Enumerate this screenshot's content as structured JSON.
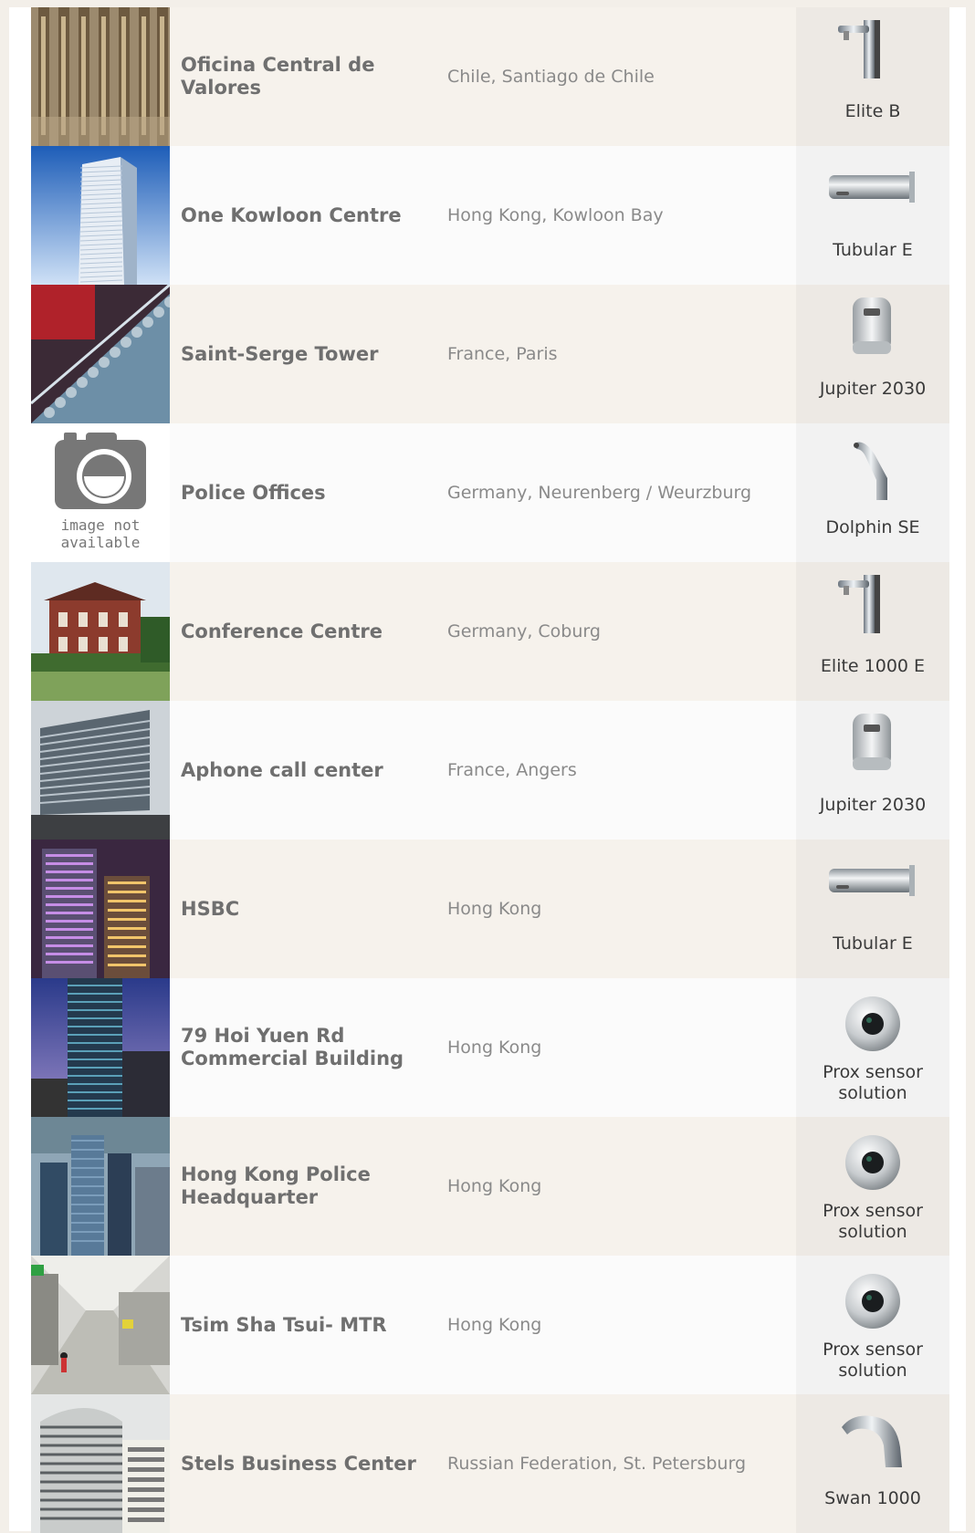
{
  "rows": [
    {
      "name": "Oficina Central de Valores",
      "location": "Chile, Santiago de Chile",
      "product": "Elite B",
      "product_icon": "elite-faucet-icon",
      "thumb": "gold-facade"
    },
    {
      "name": "One Kowloon Centre",
      "location": "Hong Kong, Kowloon Bay",
      "product": "Tubular E",
      "product_icon": "tubular-spout-icon",
      "thumb": "blue-tower"
    },
    {
      "name": "Saint-Serge Tower",
      "location": "France, Paris",
      "product": "Jupiter 2030",
      "product_icon": "jupiter-sensor-icon",
      "thumb": "red-glass"
    },
    {
      "name": "Police Offices",
      "location": "Germany, Neurenberg / Weurzburg",
      "product": "Dolphin SE",
      "product_icon": "dolphin-faucet-icon",
      "thumb": "not-available",
      "thumb_text": [
        "image not",
        "available"
      ]
    },
    {
      "name": "Conference Centre",
      "location": "Germany, Coburg",
      "product": "Elite 1000 E",
      "product_icon": "elite-faucet-icon",
      "thumb": "brick-house"
    },
    {
      "name": "Aphone call center",
      "location": "France, Angers",
      "product": "Jupiter 2030",
      "product_icon": "jupiter-sensor-icon",
      "thumb": "glass-building"
    },
    {
      "name": "HSBC",
      "location": "Hong Kong",
      "product": "Tubular E",
      "product_icon": "tubular-spout-icon",
      "thumb": "night-city"
    },
    {
      "name": "79 Hoi Yuen Rd Commercial Building",
      "location": "Hong Kong",
      "product": "Prox sensor solution",
      "product_icon": "prox-sensor-icon",
      "thumb": "dusk-tower"
    },
    {
      "name": "Hong Kong Police Headquarter",
      "location": "Hong Kong",
      "product": "Prox sensor solution",
      "product_icon": "prox-sensor-icon",
      "thumb": "skyline"
    },
    {
      "name": "Tsim Sha Tsui- MTR",
      "location": "Hong Kong",
      "product": "Prox sensor solution",
      "product_icon": "prox-sensor-icon",
      "thumb": "metro-station"
    },
    {
      "name": "Stels Business Center",
      "location": "Russian Federation, St. Petersburg",
      "product": "Swan 1000",
      "product_icon": "swan-faucet-icon",
      "thumb": "round-building"
    }
  ],
  "colors": {
    "name_text": "#6f6f6f",
    "location_text": "#8a8a8a",
    "product_text": "#3a3a3a",
    "row_alt": "#f6f2ec",
    "row_plain": "#fbfbfb"
  }
}
